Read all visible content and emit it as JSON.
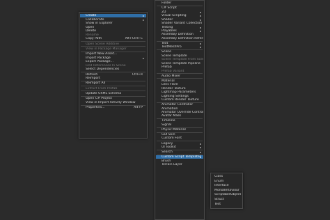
{
  "context_menu": {
    "items": [
      {
        "label": "Create",
        "submenu": true,
        "state": "highlight"
      },
      {
        "label": "Collaborate",
        "submenu": true
      },
      {
        "label": "Show in Explorer"
      },
      {
        "label": "Open"
      },
      {
        "label": "Delete"
      },
      {
        "label": "Rename",
        "state": "disabled"
      },
      {
        "label": "Copy Path",
        "shortcut": "Alt+Ctrl+C"
      },
      {
        "sep": true
      },
      {
        "label": "Open Scene Additive",
        "state": "disabled"
      },
      {
        "sep": true
      },
      {
        "label": "View in Package Manager",
        "state": "disabled"
      },
      {
        "sep": true
      },
      {
        "label": "Import New Asset..."
      },
      {
        "label": "Import Package",
        "submenu": true
      },
      {
        "label": "Export Package..."
      },
      {
        "label": "Find References In Scene",
        "state": "disabled"
      },
      {
        "label": "Select Dependencies"
      },
      {
        "sep": true
      },
      {
        "label": "Refresh",
        "shortcut": "Ctrl+R"
      },
      {
        "label": "Reimport"
      },
      {
        "sep": true
      },
      {
        "label": "Reimport All"
      },
      {
        "sep": true
      },
      {
        "label": "Extract From Prefab",
        "state": "disabled"
      },
      {
        "sep": true
      },
      {
        "label": "Update UXML Schema"
      },
      {
        "sep": true
      },
      {
        "label": "Open C# Project"
      },
      {
        "label": "View in Import Activity Window"
      },
      {
        "sep": true
      },
      {
        "label": "Properties...",
        "shortcut": "Alt+P"
      }
    ]
  },
  "create_submenu": {
    "items": [
      {
        "label": "Folder"
      },
      {
        "sep": true
      },
      {
        "label": "C# Script"
      },
      {
        "label": "2D",
        "submenu": true
      },
      {
        "label": "Visual Scripting",
        "submenu": true
      },
      {
        "label": "Shader",
        "submenu": true
      },
      {
        "label": "Shader Variant Collection"
      },
      {
        "label": "Testing",
        "submenu": true
      },
      {
        "label": "Playables",
        "submenu": true
      },
      {
        "label": "Assembly Definition"
      },
      {
        "label": "Assembly Definition Reference"
      },
      {
        "sep": true
      },
      {
        "label": "Text",
        "submenu": true
      },
      {
        "label": "TextMeshPro",
        "submenu": true
      },
      {
        "sep": true
      },
      {
        "label": "Scene"
      },
      {
        "label": "Scene Template"
      },
      {
        "label": "Scene Template From Scene",
        "state": "disabled"
      },
      {
        "label": "Scene Template Pipeline"
      },
      {
        "label": "Prefab"
      },
      {
        "label": "Prefab Variant",
        "state": "disabled"
      },
      {
        "sep": true
      },
      {
        "label": "Audio Mixer"
      },
      {
        "sep": true
      },
      {
        "label": "Material"
      },
      {
        "label": "Lens Flare"
      },
      {
        "label": "Render Texture"
      },
      {
        "label": "Lightmap Parameters"
      },
      {
        "label": "Lighting Settings"
      },
      {
        "label": "Custom Render Texture"
      },
      {
        "sep": true
      },
      {
        "label": "Animator Controller"
      },
      {
        "label": "Animation"
      },
      {
        "label": "Animator Override Controller"
      },
      {
        "label": "Avatar Mask"
      },
      {
        "sep": true
      },
      {
        "label": "Timeline"
      },
      {
        "label": "Signal"
      },
      {
        "sep": true
      },
      {
        "label": "Physic Material"
      },
      {
        "sep": true
      },
      {
        "label": "GUI Skin"
      },
      {
        "label": "Custom Font"
      },
      {
        "sep": true
      },
      {
        "label": "Legacy",
        "submenu": true
      },
      {
        "label": "UI Toolkit",
        "submenu": true
      },
      {
        "sep": true
      },
      {
        "label": "Search",
        "submenu": true
      },
      {
        "sep": true
      },
      {
        "label": "Custom Script Templates",
        "submenu": true,
        "state": "highlight"
      },
      {
        "label": "Brush"
      },
      {
        "label": "Terrain Layer"
      }
    ]
  },
  "templates_submenu": {
    "items": [
      {
        "label": "Class"
      },
      {
        "label": "Enum"
      },
      {
        "label": "Interface"
      },
      {
        "label": "MonoBehaviour"
      },
      {
        "label": "ScriptableObject"
      },
      {
        "label": "Struct"
      },
      {
        "label": "Test"
      }
    ]
  },
  "icons": {
    "submenu_arrow": "chevron-right-icon",
    "glyph": "▸"
  },
  "colors": {
    "highlight": "#2f6ea7",
    "menu_bg": "#282828",
    "backdrop": "#2b2b2b"
  }
}
